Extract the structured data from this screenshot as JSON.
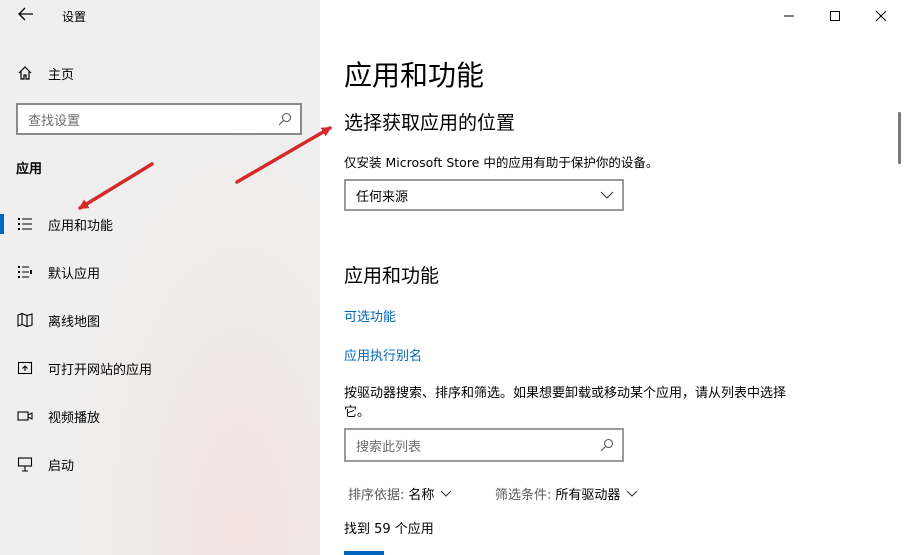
{
  "window": {
    "title": "设置",
    "back_icon": "back-arrow-icon",
    "controls": [
      "minimize-icon",
      "maximize-icon",
      "close-icon"
    ]
  },
  "sidebar": {
    "home_label": "主页",
    "search_placeholder": "查找设置",
    "section_label": "应用",
    "items": [
      {
        "label": "应用和功能",
        "icon": "apps-list-icon",
        "active": true
      },
      {
        "label": "默认应用",
        "icon": "default-apps-icon"
      },
      {
        "label": "离线地图",
        "icon": "map-icon"
      },
      {
        "label": "可打开网站的应用",
        "icon": "open-window-icon"
      },
      {
        "label": "视频播放",
        "icon": "video-icon"
      },
      {
        "label": "启动",
        "icon": "startup-icon"
      }
    ]
  },
  "main": {
    "title": "应用和功能",
    "choose_title": "选择获取应用的位置",
    "choose_desc": "仅安装 Microsoft Store 中的应用有助于保护你的设备。",
    "source_value": "任何来源",
    "section_title": "应用和功能",
    "link_optional": "可选功能",
    "link_alias": "应用执行别名",
    "help_text": "按驱动器搜索、排序和筛选。如果想要卸载或移动某个应用，请从列表中选择它。",
    "list_search_placeholder": "搜索此列表",
    "sort_label": "排序依据:",
    "sort_value": "名称",
    "filter_label": "筛选条件:",
    "filter_value": "所有驱动器",
    "count_text": "找到 59 个应用"
  },
  "colors": {
    "accent": "#0067c0",
    "link": "#0067b8",
    "annotation_arrow": "#d42a2a",
    "sidebar_bg": "#efefef"
  }
}
